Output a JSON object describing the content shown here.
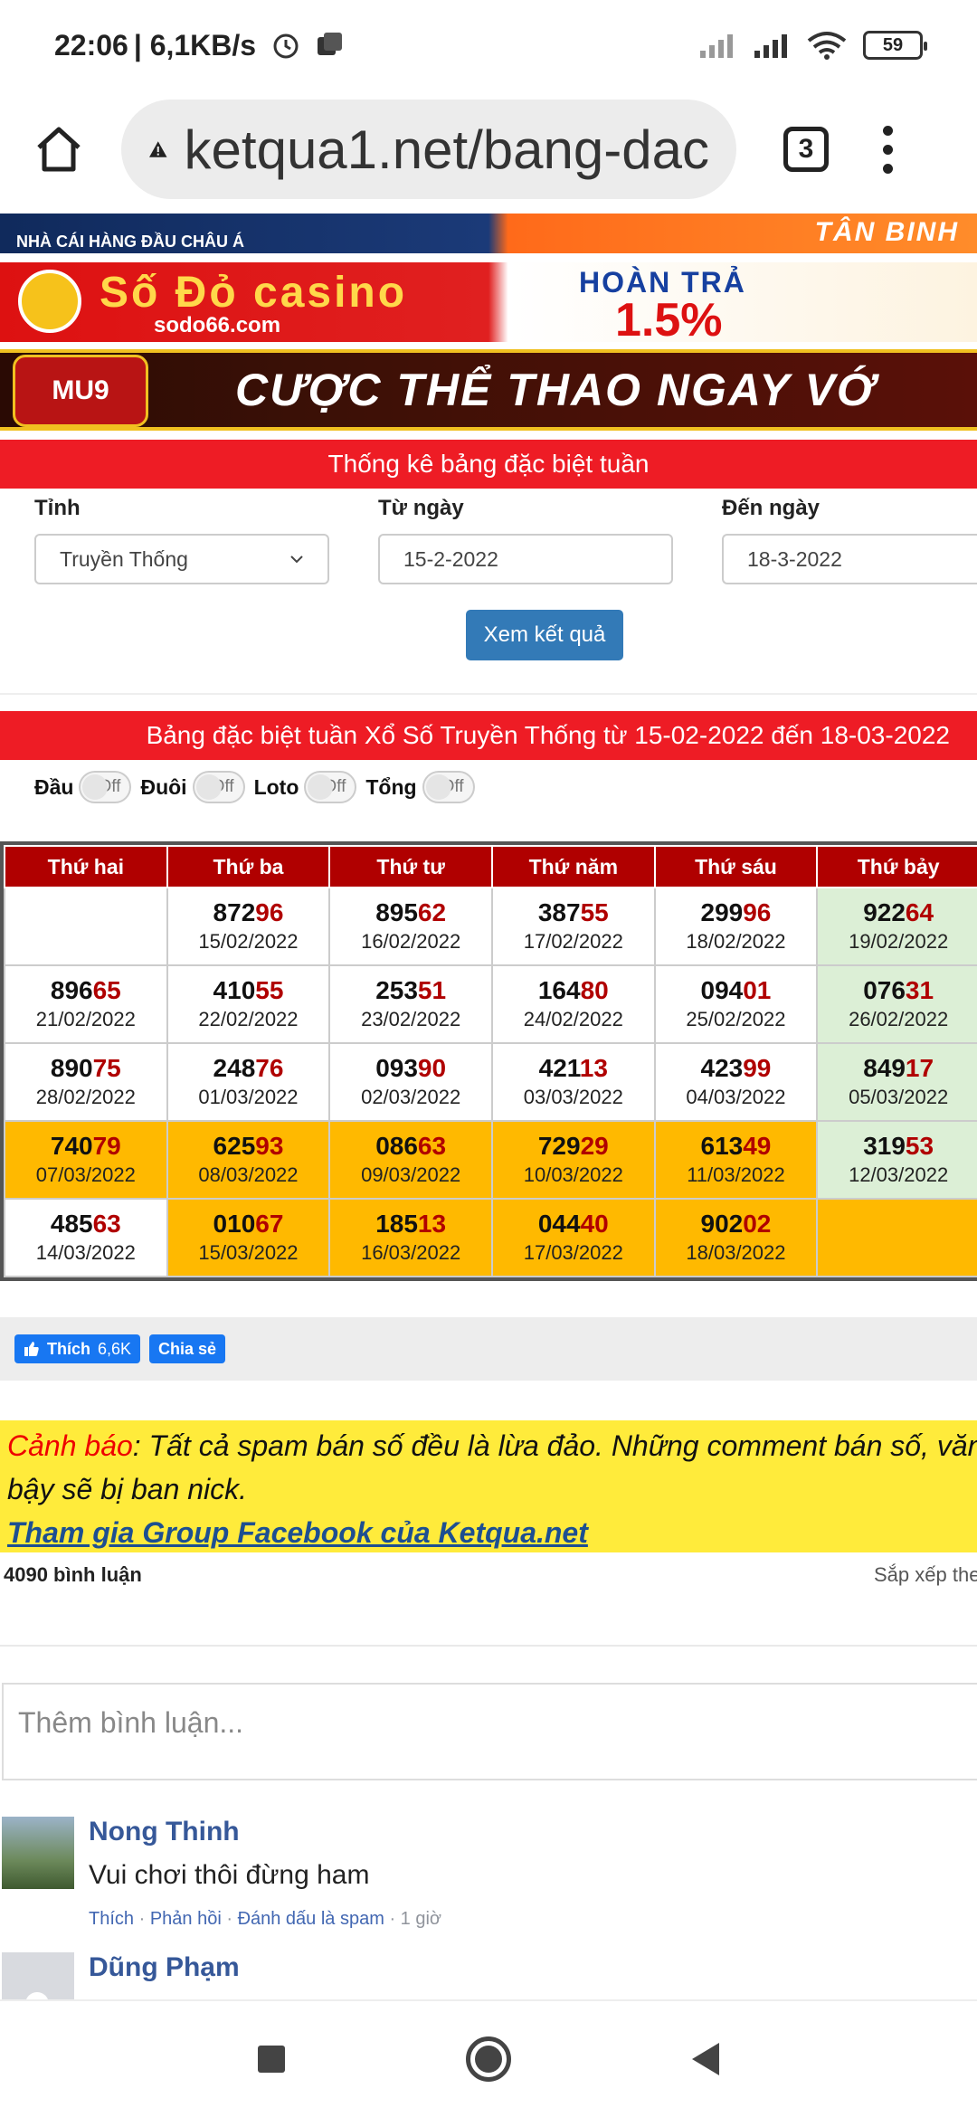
{
  "status_bar": {
    "time": "22:06",
    "speed": "| 6,1KB/s",
    "battery": "59"
  },
  "browser": {
    "url": "ketqua1.net/bang-dac",
    "tab_count": "3"
  },
  "banners": {
    "banner1_left": "NHÀ CÁI HÀNG ĐẦU CHÂU Á",
    "banner1_right": "TÂN BINH",
    "banner2_brand": "Số Đỏ casino",
    "banner2_site": "sodo66.com",
    "banner2_hoan": "HOÀN TRẢ",
    "banner2_pct": "1.5%",
    "banner3_logo": "MU9",
    "banner3_text": "CƯỢC THỂ THAO NGAY VỚ"
  },
  "form": {
    "header": "Thống kê bảng đặc biệt tuần",
    "province_label": "Tỉnh",
    "province_value": "Truyền Thống",
    "from_label": "Từ ngày",
    "from_value": "15-2-2022",
    "to_label": "Đến ngày",
    "to_value": "18-3-2022",
    "submit": "Xem kết quả"
  },
  "results": {
    "header": "Bảng đặc biệt tuần Xổ Số Truyền Thống từ 15-02-2022 đến 18-03-2022",
    "toggles": [
      {
        "label": "Đầu",
        "state": "Off"
      },
      {
        "label": "Đuôi",
        "state": "Off"
      },
      {
        "label": "Loto",
        "state": "Off"
      },
      {
        "label": "Tổng",
        "state": "Off"
      }
    ],
    "columns": [
      "Thứ hai",
      "Thứ ba",
      "Thứ tư",
      "Thứ năm",
      "Thứ sáu",
      "Thứ bảy"
    ],
    "rows": [
      [
        null,
        {
          "head": "872",
          "tail": "96",
          "date": "15/02/2022"
        },
        {
          "head": "895",
          "tail": "62",
          "date": "16/02/2022"
        },
        {
          "head": "387",
          "tail": "55",
          "date": "17/02/2022"
        },
        {
          "head": "299",
          "tail": "96",
          "date": "18/02/2022"
        },
        {
          "head": "922",
          "tail": "64",
          "date": "19/02/2022"
        }
      ],
      [
        {
          "head": "896",
          "tail": "65",
          "date": "21/02/2022"
        },
        {
          "head": "410",
          "tail": "55",
          "date": "22/02/2022"
        },
        {
          "head": "253",
          "tail": "51",
          "date": "23/02/2022"
        },
        {
          "head": "164",
          "tail": "80",
          "date": "24/02/2022"
        },
        {
          "head": "094",
          "tail": "01",
          "date": "25/02/2022"
        },
        {
          "head": "076",
          "tail": "31",
          "date": "26/02/2022"
        }
      ],
      [
        {
          "head": "890",
          "tail": "75",
          "date": "28/02/2022"
        },
        {
          "head": "248",
          "tail": "76",
          "date": "01/03/2022"
        },
        {
          "head": "093",
          "tail": "90",
          "date": "02/03/2022"
        },
        {
          "head": "421",
          "tail": "13",
          "date": "03/03/2022"
        },
        {
          "head": "423",
          "tail": "99",
          "date": "04/03/2022"
        },
        {
          "head": "849",
          "tail": "17",
          "date": "05/03/2022"
        }
      ],
      [
        {
          "head": "740",
          "tail": "79",
          "date": "07/03/2022"
        },
        {
          "head": "625",
          "tail": "93",
          "date": "08/03/2022"
        },
        {
          "head": "086",
          "tail": "63",
          "date": "09/03/2022"
        },
        {
          "head": "729",
          "tail": "29",
          "date": "10/03/2022"
        },
        {
          "head": "613",
          "tail": "49",
          "date": "11/03/2022"
        },
        {
          "head": "319",
          "tail": "53",
          "date": "12/03/2022"
        }
      ],
      [
        {
          "head": "485",
          "tail": "63",
          "date": "14/03/2022"
        },
        {
          "head": "010",
          "tail": "67",
          "date": "15/03/2022"
        },
        {
          "head": "185",
          "tail": "13",
          "date": "16/03/2022"
        },
        {
          "head": "044",
          "tail": "40",
          "date": "17/03/2022"
        },
        {
          "head": "902",
          "tail": "02",
          "date": "18/03/2022"
        },
        null
      ]
    ],
    "highlight_rows": {
      "row3": [
        true,
        true,
        true,
        true,
        true,
        false
      ],
      "row4": [
        false,
        true,
        true,
        true,
        true,
        true
      ]
    }
  },
  "social": {
    "like_label": "Thích",
    "like_count": "6,6K",
    "share_label": "Chia sẻ"
  },
  "warning": {
    "label": "Cảnh báo",
    "text": ": Tất cả spam bán số đều là lừa đảo. Những comment bán số, văn",
    "text2": "bậy sẽ bị ban nick.",
    "link": "Tham gia Group Facebook của Ketqua.net"
  },
  "comments": {
    "count": "4090 bình luận",
    "sort": "Sắp xếp the",
    "input_placeholder": "Thêm bình luận...",
    "items": [
      {
        "author": "Nong Thinh",
        "text": "Vui chơi thôi đừng ham",
        "like": "Thích",
        "reply": "Phản hồi",
        "spam": "Đánh dấu là spam",
        "time": "1 giờ"
      },
      {
        "author": "Dũng Phạm"
      }
    ]
  }
}
